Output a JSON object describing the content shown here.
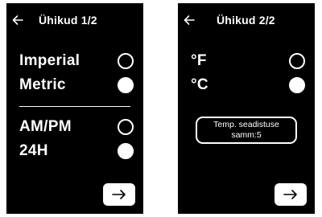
{
  "screen1": {
    "title": "Ühikud 1/2",
    "options": [
      {
        "label": "Imperial",
        "selected": false
      },
      {
        "label": "Metric",
        "selected": true
      },
      {
        "label": "AM/PM",
        "selected": false
      },
      {
        "label": "24H",
        "selected": true
      }
    ],
    "icons": {
      "back": "arrow-left-icon",
      "next": "arrow-right-icon"
    }
  },
  "screen2": {
    "title": "Ühikud 2/2",
    "options": [
      {
        "label": "°F",
        "selected": false
      },
      {
        "label": "°C",
        "selected": true
      }
    ],
    "step_line1": "Temp. seadistuse",
    "step_line2": "samm:5",
    "icons": {
      "back": "arrow-left-icon",
      "next": "arrow-right-icon"
    }
  },
  "colors": {
    "background": "#000000",
    "foreground": "#ffffff"
  }
}
